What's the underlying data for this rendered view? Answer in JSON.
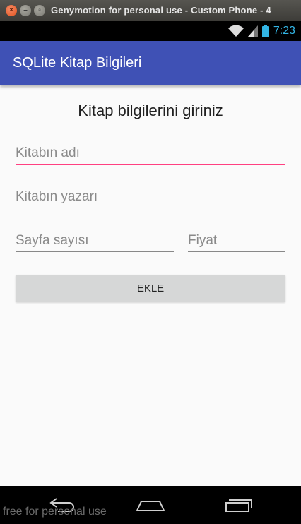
{
  "window": {
    "title": "Genymotion for personal use - Custom Phone - 4",
    "close_icon": "close-icon",
    "minimize_icon": "minimize-icon",
    "maximize_icon": "maximize-icon"
  },
  "statusbar": {
    "time": "7:23",
    "icons": [
      "wifi-icon",
      "signal-icon",
      "battery-icon"
    ],
    "accent_color": "#33b5e5"
  },
  "appbar": {
    "title": "SQLite Kitap Bilgileri",
    "color": "#3f51b5"
  },
  "form": {
    "heading": "Kitap bilgilerini giriniz",
    "book_name_placeholder": "Kitabın adı",
    "author_placeholder": "Kitabın yazarı",
    "pages_placeholder": "Sayfa sayısı",
    "price_placeholder": "Fiyat",
    "submit_label": "EKLE",
    "focus_color": "#ff4081"
  },
  "navbar": {
    "icons": [
      "back-icon",
      "home-icon",
      "recents-icon"
    ]
  },
  "watermark": "free for personal use"
}
